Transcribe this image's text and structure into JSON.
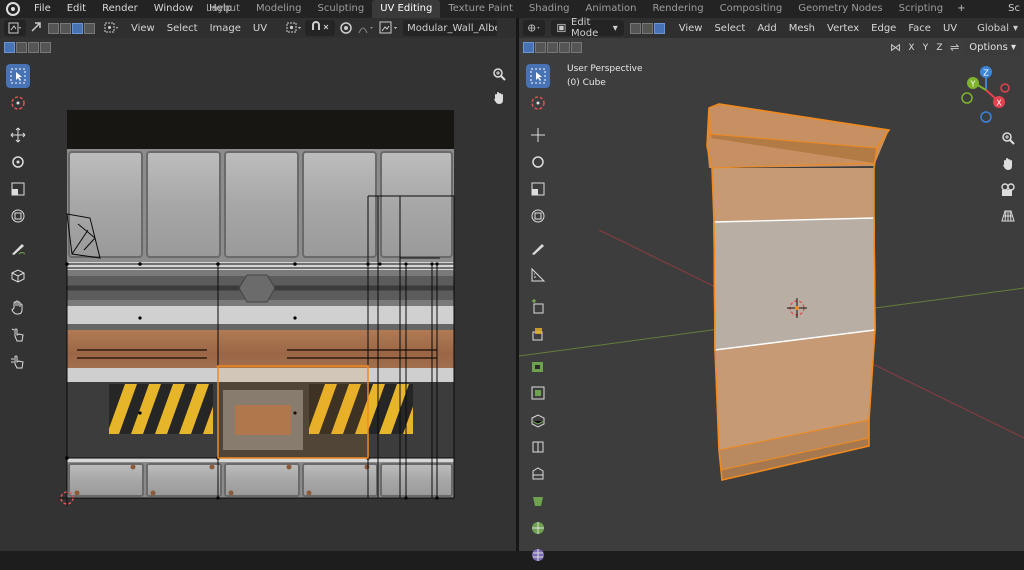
{
  "topbar": {
    "menus": [
      "File",
      "Edit",
      "Render",
      "Window",
      "Help"
    ],
    "workspaces": [
      "Layout",
      "Modeling",
      "Sculpting",
      "UV Editing",
      "Texture Paint",
      "Shading",
      "Animation",
      "Rendering",
      "Compositing",
      "Geometry Nodes",
      "Scripting"
    ],
    "active_workspace": "UV Editing",
    "add_tab": "+",
    "overflow": "Sc"
  },
  "uv_editor": {
    "menus": [
      "View",
      "Select",
      "Image",
      "UV"
    ],
    "image_name": "Modular_Wall_Albedo."
  },
  "viewport": {
    "mode": "Edit Mode",
    "menus": [
      "View",
      "Select",
      "Add",
      "Mesh",
      "Vertex",
      "Edge",
      "Face",
      "UV"
    ],
    "transform_orientation": "Global",
    "perspective_label": "User Perspective",
    "object_label": "(0) Cube",
    "axis_toggles": [
      "X",
      "Y",
      "Z"
    ],
    "options_label": "Options",
    "gizmo_axes": [
      "Z",
      "Y",
      "X"
    ]
  },
  "colors": {
    "selection_orange": "#f08a1e",
    "active_blue": "#4772b3",
    "hazard_yellow": "#e7b52a",
    "axis_x": "#e6404f",
    "axis_y": "#7fb32b",
    "axis_z": "#3c84d6"
  }
}
